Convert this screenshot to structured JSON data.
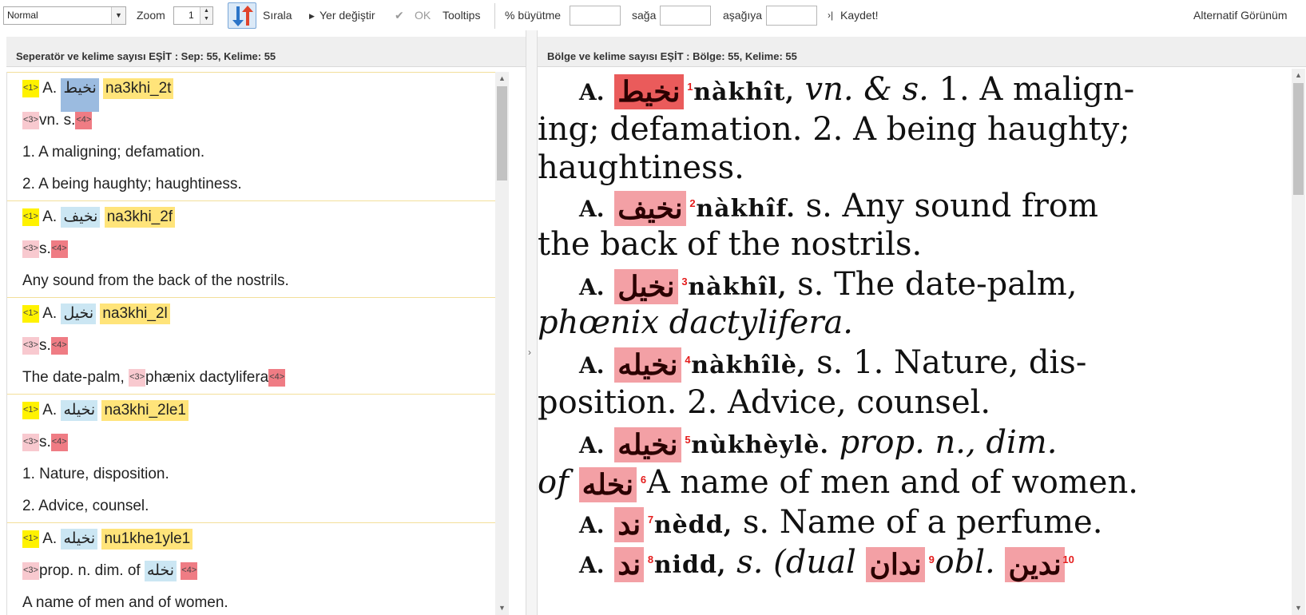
{
  "toolbar": {
    "mode_value": "Normal",
    "zoom_label": "Zoom",
    "zoom_value": "1",
    "sort_label": "Sırala",
    "move_label": "Yer değiştir",
    "ok_label": "OK",
    "tooltips_label": "Tooltips",
    "scale_label": "% büyütme",
    "right_label": "sağa",
    "down_label": "aşağıya",
    "save_label": "Kaydet!",
    "alt_view_label": "Alternatif Görünüm"
  },
  "left_header": "Seperatör ve kelime sayısı EŞİT  :  Sep: 55, Kelime: 55",
  "right_header": "Bölge ve kelime sayısı EŞİT  :  Bölge: 55, Kelime: 55",
  "entries": [
    {
      "marker1": "<1>",
      "prefix": "A.",
      "arabic": "نخيط",
      "translit": "na3khi_2t",
      "marker3": "<3>",
      "pos": "vn. s.",
      "marker4": "<4>",
      "defs": [
        "1. A maligning; defamation.",
        "2. A being haughty; haughtiness."
      ]
    },
    {
      "marker1": "<1>",
      "prefix": "A.",
      "arabic": "نخيف",
      "translit": "na3khi_2f",
      "marker3": "<3>",
      "pos": "s.",
      "marker4": "<4>",
      "defs": [
        "Any sound from the back of the nostrils."
      ]
    },
    {
      "marker1": "<1>",
      "prefix": "A.",
      "arabic": "نخيل",
      "translit": "na3khi_2l",
      "marker3": "<3>",
      "pos": "s.",
      "marker4": "<4>",
      "def_start": "The date-palm, ",
      "def_marker": "<3>",
      "def_rest": "phænix dactylifera",
      "def_marker_end": "<4>"
    },
    {
      "marker1": "<1>",
      "prefix": "A.",
      "arabic": "نخيله",
      "translit": "na3khi_2le1",
      "marker3": "<3>",
      "pos": "s.",
      "marker4": "<4>",
      "defs": [
        "1. Nature, disposition.",
        "2. Advice, counsel."
      ]
    },
    {
      "marker1": "<1>",
      "prefix": "A.",
      "arabic": "نخيله",
      "translit": "nu1khe1yle1",
      "marker3": "<3>",
      "pos": "prop. n. dim. of",
      "pos_arabic": "نخله",
      "marker4": "<4>",
      "defs": [
        "A name of men and of women."
      ]
    }
  ],
  "scan": {
    "l1_a": "A.",
    "l1_ar": "نخيط",
    "l1_n": "1",
    "l1_word": "nàkhît,",
    "l1_pos": "vn. & s.",
    "l1_rest": "1. A malign-",
    "l2": "ing; defamation. 2. A being haughty;",
    "l3": "haughtiness.",
    "l4_a": "A.",
    "l4_ar": "نخيف",
    "l4_n": "2",
    "l4_word": "nàkhîf.",
    "l4_rest": "s. Any sound from",
    "l5": "the back of the nostrils.",
    "l6_a": "A.",
    "l6_ar": "نخيل",
    "l6_n": "3",
    "l6_word": "nàkhîl,",
    "l6_rest": "s.  The date-palm,",
    "l7": "phœnix dactylifera.",
    "l8_a": "A.",
    "l8_ar": "نخيله",
    "l8_n": "4",
    "l8_word": "nàkhîlè,",
    "l8_rest": "s. 1. Nature, dis-",
    "l9": "position. 2. Advice, counsel.",
    "l10_a": "A.",
    "l10_ar": "نخيله",
    "l10_n": "5",
    "l10_word": "nùkhèylè.",
    "l10_rest": "prop. n., dim.",
    "l11_of": "of",
    "l11_ar": "نخله",
    "l11_n": "6",
    "l11_rest": "A name of men and of women.",
    "l12_a": "A.",
    "l12_ar": "ند",
    "l12_n": "7",
    "l12_word": "nèdd,",
    "l12_rest": "s. Name of a perfume.",
    "l13_a": "A.",
    "l13_ar": "ند",
    "l13_n": "8",
    "l13_word": "nidd,",
    "l13_rest": "s. (dual",
    "l13_ar2": "ندان",
    "l13_n2": "9",
    "l13_obl": "obl.",
    "l13_ar3": "ندين",
    "l13_n3": "10"
  }
}
